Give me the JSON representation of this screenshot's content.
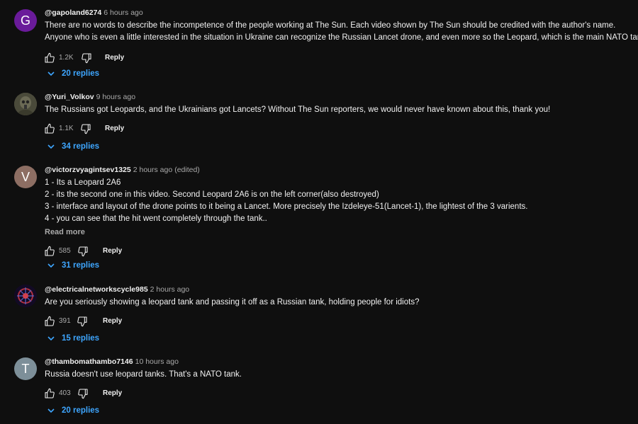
{
  "comments": [
    {
      "avatar_letter": "G",
      "avatar_color": "#6a1b9a",
      "handle": "@gapoland6274",
      "time": "6 hours ago",
      "lines": [
        "There are no words to describe the incompetence of the people working at The Sun. Each video shown by The Sun should be credited with the author's name.",
        "Anyone who is even a little interested in the situation in Ukraine can recognize the Russian Lancet drone, and even more so the Leopard, which is the main NATO tank."
      ],
      "likes": "1.2K",
      "reply_label": "Reply",
      "replies_label": "20 replies"
    },
    {
      "avatar_letter": "",
      "avatar_color": "#5c5a4a",
      "handle": "@Yuri_Volkov",
      "time": "9 hours ago",
      "lines": [
        "The Russians got Leopards, and the Ukrainians got Lancets? Without The Sun reporters, we would never have known about this, thank you!"
      ],
      "likes": "1.1K",
      "reply_label": "Reply",
      "replies_label": "34 replies"
    },
    {
      "avatar_letter": "V",
      "avatar_color": "#8d6e63",
      "handle": "@victorzvyagintsev1325",
      "time": "2 hours ago",
      "edited": "(edited)",
      "lines": [
        "1 - Its a Leopard 2A6",
        "2 - its the second one in this video.  Second Leopard 2A6 is on the left corner(also destroyed)",
        "3 - interface and layout of the drone points to it being a Lancet.  More precisely the Izdeleye-51(Lancet-1), the lightest of the 3 varients.",
        "4 - you can see that the hit went completely through the tank.."
      ],
      "read_more": "Read more",
      "likes": "585",
      "reply_label": "Reply",
      "replies_label": "31 replies"
    },
    {
      "avatar_letter": "",
      "avatar_color": "#1a1030",
      "handle": "@electricalnetworkscycle985",
      "time": "2 hours ago",
      "lines": [
        "Are you seriously showing a leopard tank and passing it off as a Russian tank, holding people for idiots?"
      ],
      "likes": "391",
      "reply_label": "Reply",
      "replies_label": "15 replies"
    },
    {
      "avatar_letter": "T",
      "avatar_color": "#7d8f99",
      "handle": "@thambomathambo7146",
      "time": "10 hours ago",
      "lines": [
        "Russia doesn't use leopard tanks. That's a NATO tank."
      ],
      "likes": "403",
      "reply_label": "Reply",
      "replies_label": "20 replies"
    }
  ]
}
